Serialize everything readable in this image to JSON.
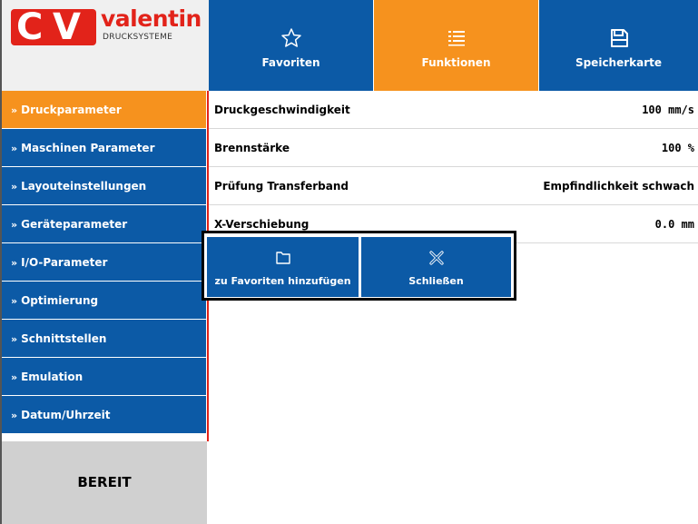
{
  "logo": {
    "mark_left": "C",
    "mark_right": "V",
    "word": "valentin",
    "sub": "DRUCKSYSTEME"
  },
  "tabs": [
    {
      "label": "Favoriten",
      "icon": "star-icon",
      "active": false
    },
    {
      "label": "Funktionen",
      "icon": "list-icon",
      "active": true
    },
    {
      "label": "Speicherkarte",
      "icon": "save-icon",
      "active": false
    }
  ],
  "sidebar": {
    "items": [
      {
        "label": "Druckparameter",
        "active": true
      },
      {
        "label": "Maschinen Parameter",
        "active": false
      },
      {
        "label": "Layouteinstellungen",
        "active": false
      },
      {
        "label": "Geräteparameter",
        "active": false
      },
      {
        "label": "I/O-Parameter",
        "active": false
      },
      {
        "label": "Optimierung",
        "active": false
      },
      {
        "label": "Schnittstellen",
        "active": false
      },
      {
        "label": "Emulation",
        "active": false
      },
      {
        "label": "Datum/Uhrzeit",
        "active": false
      }
    ],
    "chevron": "»"
  },
  "status": "BEREIT",
  "params": [
    {
      "name": "Druckgeschwindigkeit",
      "value": "100 mm/s"
    },
    {
      "name": "Brennstärke",
      "value": "100 %"
    },
    {
      "name": "Prüfung Transferband",
      "value": "Empfindlichkeit schwach"
    },
    {
      "name": "X-Verschiebung",
      "value": "0.0 mm"
    }
  ],
  "popup": {
    "add_favorite_label": "zu Favoriten hinzufügen",
    "close_label": "Schließen"
  },
  "colors": {
    "blue": "#0c5aa6",
    "orange": "#f6921e",
    "red": "#e2231a",
    "status_bg": "#d0d0d0"
  }
}
